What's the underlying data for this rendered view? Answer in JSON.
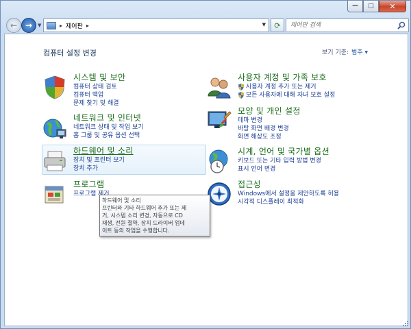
{
  "window": {
    "minimize_glyph": "—",
    "maximize_glyph": "□",
    "close_glyph": "✕"
  },
  "nav": {
    "back_glyph": "←",
    "forward_glyph": "→",
    "address_icon": "control-panel-icon",
    "address_text": "제어판",
    "search_placeholder": "제어판 검색"
  },
  "page": {
    "title": "컴퓨터 설정 변경",
    "view_by_label": "보기 기준:",
    "view_by_value": "범주 ▾"
  },
  "categories_left": [
    {
      "title": "시스템 및 보안",
      "icon": "system-security-icon",
      "links": [
        "컴퓨터 상태 검토",
        "컴퓨터 백업",
        "문제 찾기 및 해결"
      ]
    },
    {
      "title": "네트워크 및 인터넷",
      "icon": "network-internet-icon",
      "links": [
        "네트워크 상태 및 작업 보기",
        "홈 그룹 및 공유 옵션 선택"
      ]
    },
    {
      "title": "하드웨어 및 소리",
      "icon": "hardware-sound-icon",
      "links": [
        "장치 및 프린터 보기",
        "장치 추가"
      ]
    },
    {
      "title": "프로그램",
      "icon": "programs-icon",
      "links": [
        "프로그램 제거"
      ]
    }
  ],
  "categories_right": [
    {
      "title": "사용자 계정 및 가족 보호",
      "icon": "user-accounts-icon",
      "links": [
        "사용자 계정 추가 또는 제거",
        "모든 사용자에 대해 자녀 보호 설정"
      ]
    },
    {
      "title": "모양 및 개인 설정",
      "icon": "appearance-icon",
      "links": [
        "테마 변경",
        "바탕 화면 배경 변경",
        "화면 해상도 조정"
      ]
    },
    {
      "title": "시계, 언어 및 국가별 옵션",
      "icon": "clock-language-icon",
      "links": [
        "키보드 또는 기타 입력 방법 변경",
        "표시 언어 변경"
      ]
    },
    {
      "title": "접근성",
      "icon": "ease-of-access-icon",
      "links": [
        "Windows에서 설정을 제안하도록 허용",
        "시각적 디스플레이 최적화"
      ]
    }
  ],
  "tooltip": {
    "lines": [
      "하드웨어 및 소리",
      "프린터와 기타 하드웨어 추가 또는 제",
      "거, 시스템 소리 변경, 자동으로 CD",
      "재생, 전원 절약, 장치 드라이버 업데",
      "이트 등의 작업을 수행합니다."
    ]
  }
}
